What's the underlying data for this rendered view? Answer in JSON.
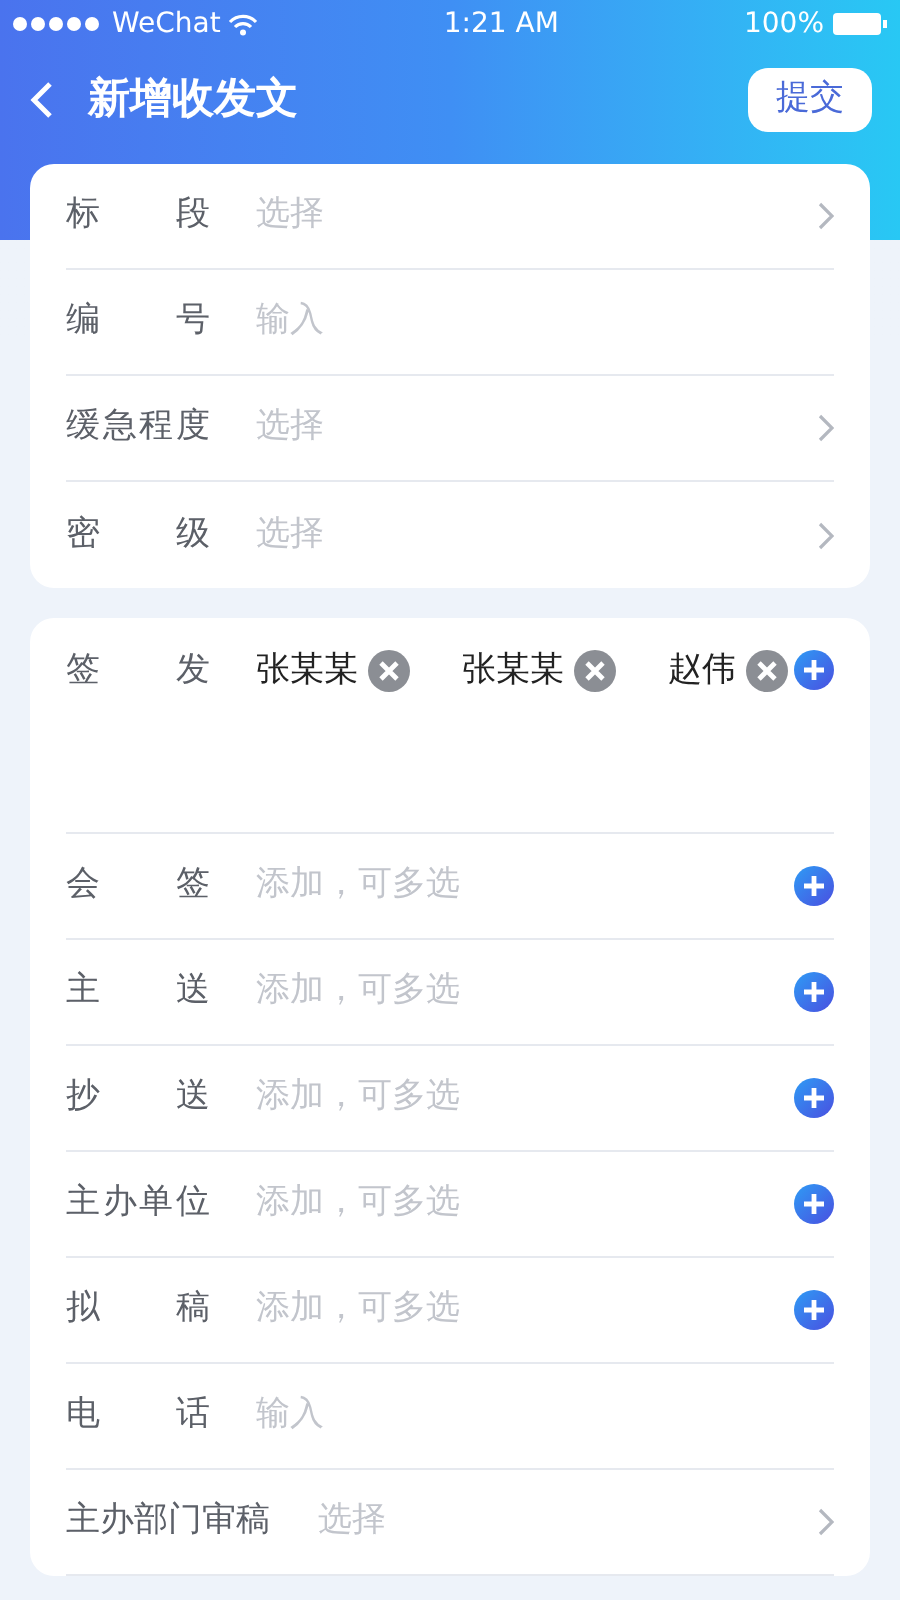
{
  "status_bar": {
    "carrier": "WeChat",
    "time": "1:21 AM",
    "battery": "100%"
  },
  "nav": {
    "title": "新增收发文",
    "action": "提交"
  },
  "sections": [
    {
      "rows": [
        {
          "kind": "select",
          "label": "标段",
          "placeholder": "选择"
        },
        {
          "kind": "input",
          "label": "编号",
          "placeholder": "输入"
        },
        {
          "kind": "select",
          "label": "缓急程度",
          "placeholder": "选择"
        },
        {
          "kind": "select",
          "label": "密级",
          "placeholder": "选择"
        }
      ]
    },
    {
      "rows": [
        {
          "kind": "people",
          "label": "签发",
          "people": [
            "张某某",
            "张某某",
            "赵伟"
          ]
        },
        {
          "kind": "add",
          "label": "会签",
          "placeholder": "添加，可多选"
        },
        {
          "kind": "add",
          "label": "主送",
          "placeholder": "添加，可多选"
        },
        {
          "kind": "add",
          "label": "抄送",
          "placeholder": "添加，可多选"
        },
        {
          "kind": "add",
          "label": "主办单位",
          "placeholder": "添加，可多选"
        },
        {
          "kind": "add",
          "label": "拟稿",
          "placeholder": "添加，可多选"
        },
        {
          "kind": "input",
          "label": "电话",
          "placeholder": "输入"
        },
        {
          "kind": "select",
          "label": "主办部门审稿",
          "placeholder": "选择"
        }
      ]
    }
  ]
}
